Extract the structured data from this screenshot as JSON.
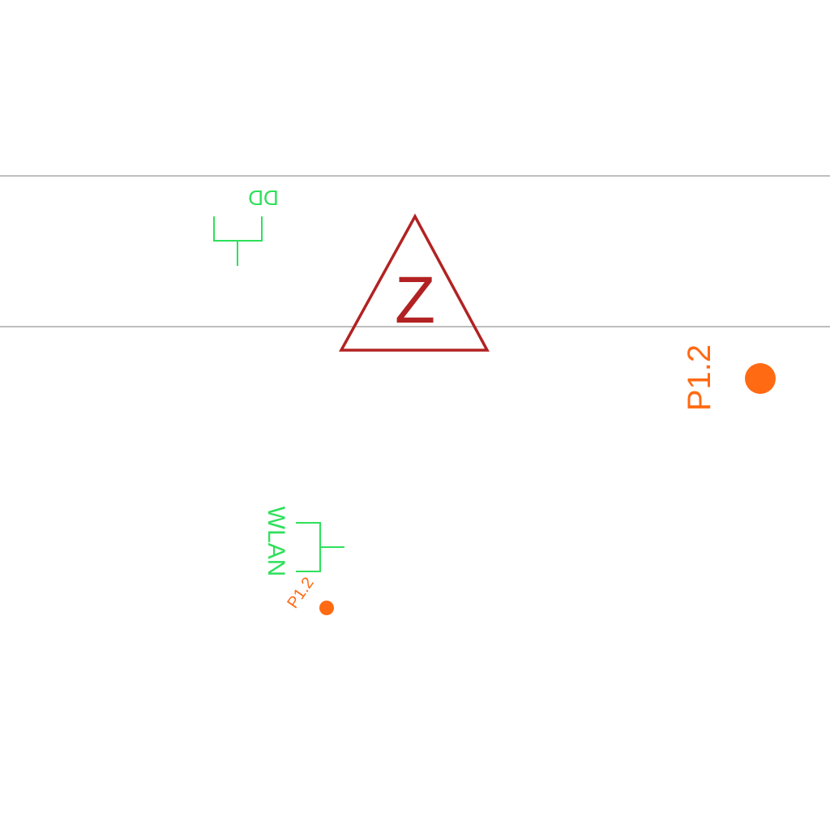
{
  "colors": {
    "background": "#ffffff",
    "wall_line": "#a8a8a8",
    "outlet_symbol": "#2ee05a",
    "marker_triangle": "#b22222",
    "point_marker": "#ff6a13"
  },
  "icons": {
    "data_outlet": "network-outlet-icon",
    "wlan_outlet": "wlan-outlet-icon",
    "marker": "triangle-warning-icon",
    "point": "point-dot-icon"
  },
  "symbols": {
    "data_outlet_label": "DD",
    "wlan_outlet_label": "WLAN",
    "triangle_letter": "Z",
    "point_label_large": "P1.2",
    "point_label_small": "P1.2"
  }
}
